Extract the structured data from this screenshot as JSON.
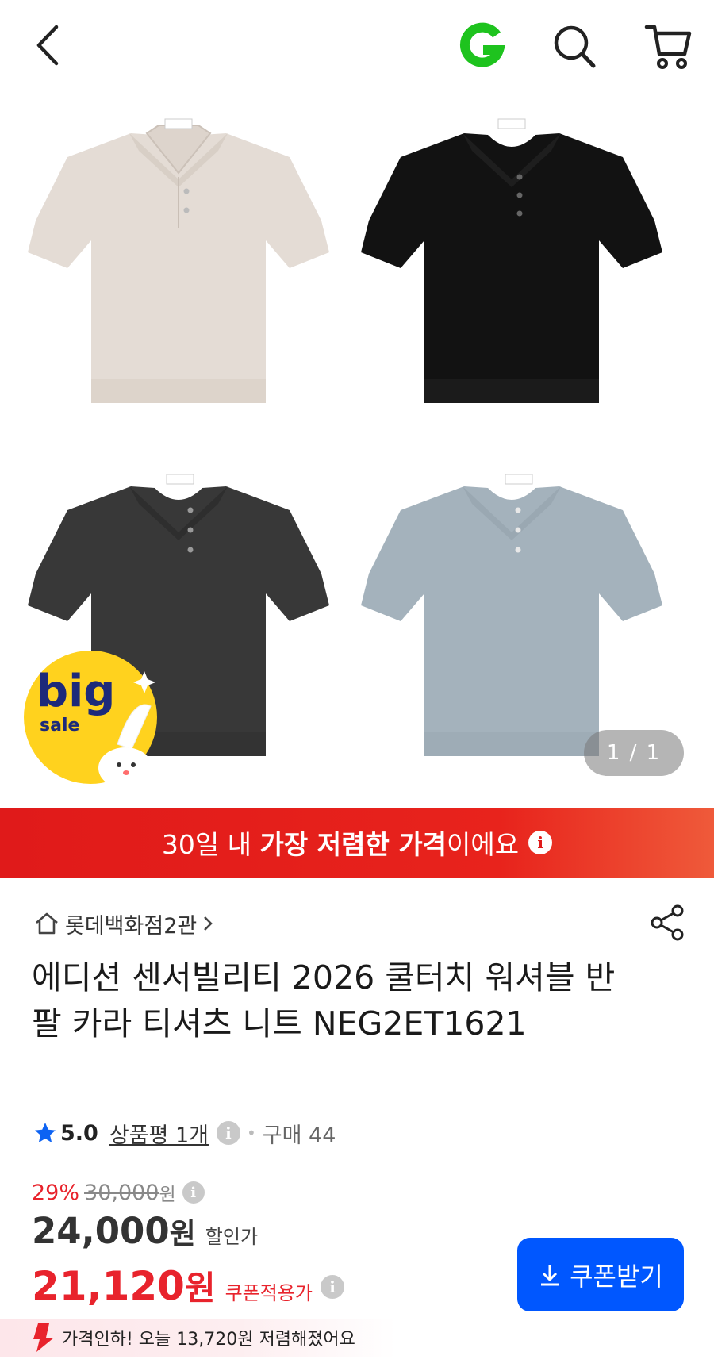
{
  "header": {
    "back_icon": "chevron-left-icon",
    "logo_icon": "gmarket-g-logo",
    "logo_color": "#1ec31e",
    "search_icon": "search-icon",
    "cart_icon": "cart-icon"
  },
  "gallery": {
    "counter": "1 / 1",
    "shirt_colors": [
      "#e4dcd5",
      "#121212",
      "#383838",
      "#a4b2bc"
    ],
    "badge": {
      "line1": "big",
      "line2": "sale"
    }
  },
  "promo_banner": {
    "text_pre": "30일 내 ",
    "text_bold": "가장 저렴한 가격",
    "text_post": "이에요",
    "color": "#e01a1a"
  },
  "store": {
    "name": "롯데백화점2관"
  },
  "product": {
    "title": "에디션 센서빌리티 2026 쿨터치 워셔블 반팔 카라 티셔츠 니트 NEG2ET1621"
  },
  "rating": {
    "score": "5.0",
    "reviews_label": "상품평 1개",
    "purchases_label": "구매 44"
  },
  "price": {
    "discount_rate": "29%",
    "original": "30,000",
    "original_unit": "원",
    "sale_amount": "24,000",
    "sale_unit": "원",
    "sale_label": "할인가",
    "coupon_amount": "21,120",
    "coupon_unit": "원",
    "coupon_label": "쿠폰적용가",
    "accent_color": "#e8232c"
  },
  "coupon_button": {
    "label": "쿠폰받기",
    "color": "#0057ff"
  },
  "price_drop": {
    "text": "가격인하! 오늘 13,720원 저렴해졌어요"
  }
}
